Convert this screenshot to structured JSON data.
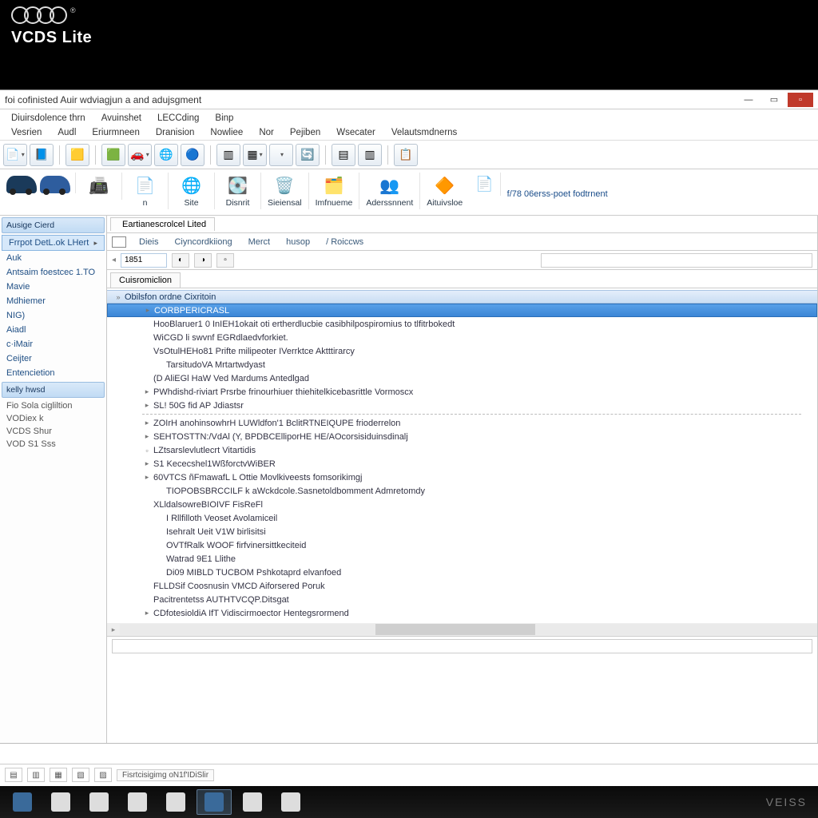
{
  "brand": {
    "name": "VCDS Lite",
    "trademark": "®"
  },
  "title": "foi cofinisted Auir wdviagjun a and adujsgment",
  "menus": {
    "row1": [
      "Diuirsdolence thrn",
      "Avuinshet",
      "LECCding",
      "Binp"
    ],
    "row2": [
      "Vesrien",
      "Audl",
      "Eriurmneen",
      "Dranision",
      "Nowliee",
      "Nor",
      "Pejiben",
      "Wsecater",
      "Velautsmdnerns"
    ]
  },
  "toolbar2": {
    "items": [
      {
        "label": "n",
        "icon": "📄"
      },
      {
        "label": "Site",
        "icon": "🌐"
      },
      {
        "label": "Disnrit",
        "icon": "💽"
      },
      {
        "label": "Sieiensal",
        "icon": "🗑️"
      },
      {
        "label": "Imfnueme",
        "icon": "🗂️"
      },
      {
        "label": "Aderssnnent",
        "icon": "👥"
      },
      {
        "label": "Aituivsloe",
        "icon": "🔶"
      }
    ],
    "right_label": "f/78 06erss-poet fodtrnent"
  },
  "sidebar": {
    "header1": "Ausige Cierd",
    "first_item": "Frrpot DetL.ok LHert",
    "items_a": [
      "Auk",
      "Antsaim foestcec 1.TO",
      "Mavie",
      "Mdhiemer",
      "NIG)",
      "Aiadl",
      "c·iMair",
      "Ceijter",
      "Entencietion"
    ],
    "header2": "kelly hwsd",
    "items_b": [
      "Fio Sola cigliltion",
      "VODiex k",
      "VCDS Shur",
      "VOD S1 Sss"
    ]
  },
  "main": {
    "breadcrumb_tab": "Eartianescrolcel Lited",
    "subtabs": [
      "Dieis",
      "Ciyncordkiiong",
      "Merct",
      "husop",
      "/ Roiccws"
    ],
    "filter_value": "1851",
    "section_tab": "Cuisromiclion",
    "tree": {
      "header": "Obilsfon ordne Cixritoin",
      "selected": "CORBPERICRASL",
      "lines": [
        {
          "ind": 2,
          "tw": "",
          "txt": "HooBlaruer1 0   InIEH1okait oti ertherdlucbie casibhilpospiromius to tlfitrbokedt"
        },
        {
          "ind": 2,
          "tw": "",
          "txt": "WiCGD li swvnf EGRdlaedvforkiet."
        },
        {
          "ind": 2,
          "tw": "",
          "txt": "VsOtulHEHo81 Prifte milipeoter IVerrktce Aktttirarcy"
        },
        {
          "ind": 3,
          "tw": "",
          "txt": "TarsitudoVA Mrtartwdyast"
        },
        {
          "ind": 2,
          "tw": "",
          "txt": "(D AliEGl HaW Ved Mardums Antedlgad"
        },
        {
          "ind": 2,
          "tw": "▸",
          "txt": "PWhdishd-riviart Prsrbe frinourhiuer thiehitelkicebasrittle Vormoscx"
        },
        {
          "ind": 2,
          "tw": "▸",
          "txt": "SL! 50G fid AP Jdiastsr"
        },
        {
          "ind": 2,
          "tw": "▸",
          "txt": "ZOIrH anohinsowhrH  LUWldfon'1 BclitRTNEIQUPE frioderrelon"
        },
        {
          "ind": 2,
          "tw": "▸",
          "txt": "SEHTOSTTN:/VdAl (Y, BPDBCElliporHE HE/AOcorsisiduinsdinalj"
        },
        {
          "ind": 2,
          "tw": "▫",
          "txt": "LZtsarslevlutlecrt Vitartidis"
        },
        {
          "ind": 2,
          "tw": "▸",
          "txt": "S1 Kececshel1WßforctvWiBER"
        },
        {
          "ind": 2,
          "tw": "▸",
          "txt": "60VTCS ñFmawafL L Ottie Movlkiveests fomsorikimgj"
        },
        {
          "ind": 3,
          "tw": "",
          "txt": "TIOPOBSBRCCILF  k aWckdcole.Sasnetoldbomment Admretomdy"
        },
        {
          "ind": 2,
          "tw": "",
          "txt": "XLldalsowreBIOIVF FisReFl"
        },
        {
          "ind": 3,
          "tw": "",
          "txt": "I  Rllfilloth Veoset Avolamiceil"
        },
        {
          "ind": 3,
          "tw": "",
          "txt": "Isehralt Ueit  V1W birlisitsi"
        },
        {
          "ind": 3,
          "tw": "",
          "txt": "OVTfRalk WOOF firfvinersittkeciteid"
        },
        {
          "ind": 3,
          "tw": "",
          "txt": "Watrad 9E1 Llithe"
        },
        {
          "ind": 3,
          "tw": "",
          "txt": "Di09 MIBLD TUCBOM Pshkotaprd elvanfoed"
        },
        {
          "ind": 2,
          "tw": "",
          "txt": "FLLDSif Coosnusin VMCD Aiforsered Poruk"
        },
        {
          "ind": 2,
          "tw": "",
          "txt": "Pacitrentetss AUTHTVCQP.Ditsgat"
        },
        {
          "ind": 2,
          "tw": "▸",
          "txt": "CDfotesioldiA IfT Vidiscirmoector Hentegsrormend"
        }
      ]
    }
  },
  "footer": {
    "chip": "Fisrtcisigimg oN1f'IDiSlir"
  },
  "taskbar": {
    "brand_right": "VEISS"
  }
}
